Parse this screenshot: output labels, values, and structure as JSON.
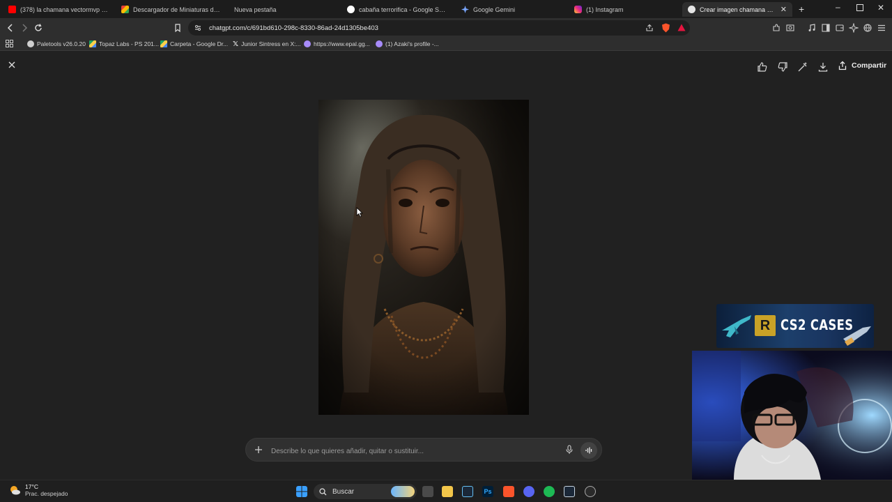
{
  "browser": {
    "tabs": [
      {
        "title": "(378) la chamana vectormvp - YouTube",
        "active": false
      },
      {
        "title": "Descargador de Miniaturas de YouTube",
        "active": false
      },
      {
        "title": "Nueva pestaña",
        "active": false
      },
      {
        "title": "cabaña terrorifica - Google Search",
        "active": false
      },
      {
        "title": "Google Gemini",
        "active": false
      },
      {
        "title": "(1) Instagram",
        "active": false
      },
      {
        "title": "Crear imagen chamana terrorifica",
        "active": true
      }
    ],
    "url": "chatgpt.com/c/691bd610-298c-8330-86ad-24d1305be403",
    "bookmarks": [
      "Paletools v26.0.20",
      "Topaz Labs - PS 201...",
      "Carpeta - Google Dr...",
      "Junior Sintress en X:...",
      "https://www.epal.gg...",
      "(1) Azaki's profile -..."
    ]
  },
  "page": {
    "share_label": "Compartir",
    "composer": {
      "placeholder": "Describe lo que quieres añadir, quitar o sustituir..."
    }
  },
  "overlay": {
    "banner_text": "CS2 CASES",
    "banner_logo": "R"
  },
  "taskbar": {
    "temperature": "17°C",
    "weather": "Prac. despejado",
    "search_label": "Buscar"
  },
  "colors": {
    "page_bg": "#212121",
    "tabstrip_bg": "#1c1c1c",
    "toolbar_bg": "#2e2e2e",
    "composer_bg": "#303030",
    "brave_orange": "#fb542b"
  }
}
